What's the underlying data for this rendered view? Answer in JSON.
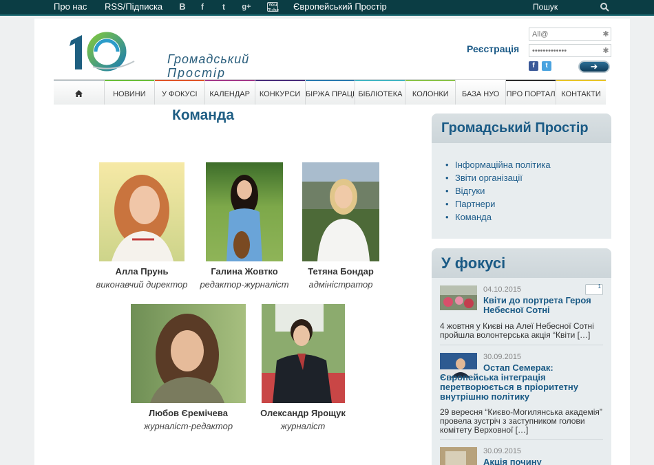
{
  "topbar": {
    "about": "Про нас",
    "rss": "RSS/Підписка",
    "social_b": "B",
    "social_f": "f",
    "social_t": "t",
    "social_g": "g+",
    "social_yt": "You Tube",
    "euro": "Європейський Простір",
    "search": "Пошук",
    "search_icon": "search-icon"
  },
  "logo": {
    "line1": "Громадський",
    "line2": "Простір"
  },
  "login": {
    "register": "Реєстрація",
    "login_placeholder": "All@",
    "password_placeholder": "•••••••••••••",
    "go_arrow": "➜"
  },
  "nav": {
    "home_icon": "⌂",
    "items": [
      "НОВИНИ",
      "У ФОКУСІ",
      "КАЛЕНДАР",
      "КОНКУРСИ",
      "БІРЖА ПРАЦІ",
      "БІБЛІОТЕКА",
      "КОЛОНКИ",
      "БАЗА НУО",
      "ПРО ПОРТАЛ",
      "КОНТАКТИ"
    ]
  },
  "colors": {
    "nav_home": "#bfc7ca",
    "nav": [
      "#6bbf3b",
      "#e0572a",
      "#a43a8a",
      "#4a2f7c",
      "#2a7ab0",
      "#44b6c3",
      "#8bc34a",
      "#ffffff",
      "#2d2d2d",
      "#e8c52a"
    ]
  },
  "content": {
    "title": "Команда",
    "members": [
      {
        "name": "Алла Прунь",
        "role": "виконавчий директор"
      },
      {
        "name": "Галина Жовтко",
        "role": "редактор-журналіст"
      },
      {
        "name": "Тетяна Бондар",
        "role": "адміністратор"
      },
      {
        "name": "Любов Єремічева",
        "role": "журналіст-редактор"
      },
      {
        "name": "Олександр Ярощук",
        "role": "журналіст"
      }
    ]
  },
  "sidebar": {
    "portal_title": "Громадський Простір",
    "portal_links": [
      "Інформаційна політика",
      "Звіти організації",
      "Відгуки",
      "Партнери",
      "Команда"
    ],
    "focus_title": "У фокусі",
    "news": [
      {
        "date": "04.10.2015",
        "title": "Квіти до портрета Героя Небесної Сотні",
        "excerpt": "4 жовтня у Києві на Алеї Небесної Сотні пройшла волонтерська акція “Квіти […]",
        "comments": "1"
      },
      {
        "date": "30.09.2015",
        "title": "Остап Семерак: Європейська інтеграція перетворюється в пріоритетну внутрішню політику",
        "excerpt": "29 вересня “Києво-Могилянська академія” провела зустріч з заступником голови комітету Верховної […]"
      },
      {
        "date": "30.09.2015",
        "title": "Акція почину"
      }
    ]
  }
}
